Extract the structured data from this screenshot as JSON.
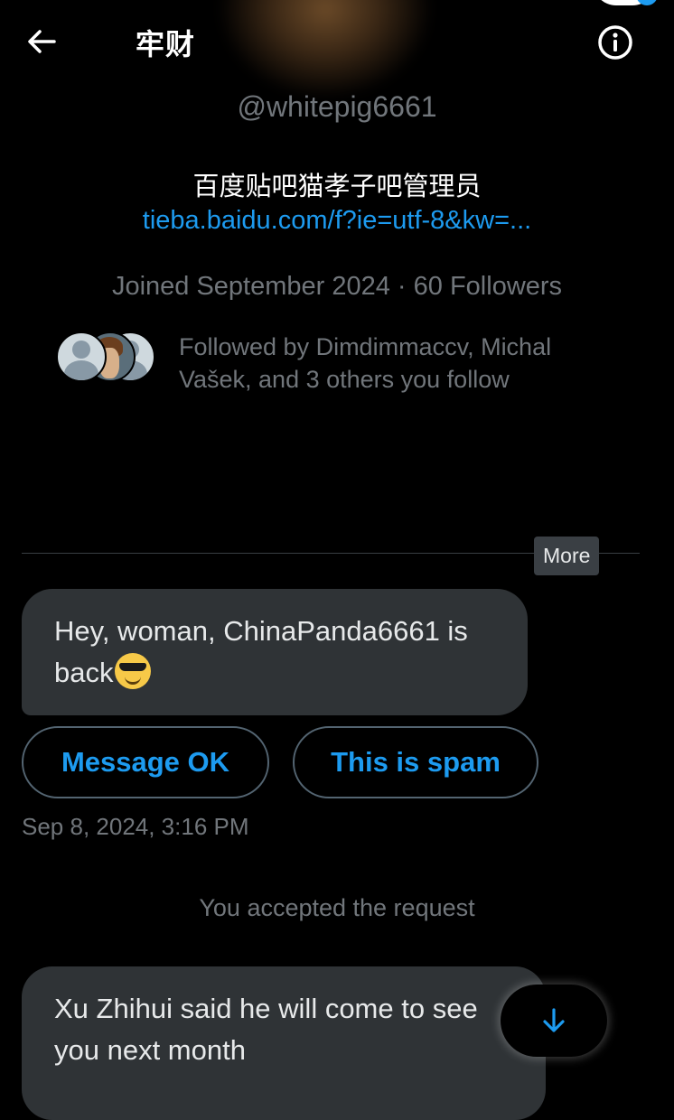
{
  "header": {
    "title": "牢财",
    "back_icon": "arrow-left-icon",
    "info_icon": "info-icon"
  },
  "profile": {
    "handle": "@whitepig6661",
    "bio": "百度贴吧猫孝子吧管理员",
    "link": "tieba.baidu.com/f?ie=utf-8&kw=...",
    "meta": "Joined September 2024 · 60 Followers",
    "followed_by": "Followed by Dimdimmaccv, Michal Vašek, and 3 others you follow"
  },
  "conversation": {
    "more_label": "More",
    "message1_text": "Hey, woman, ChinaPanda6661 is back",
    "message1_emoji": "smiling-face-with-sunglasses-icon",
    "message_ok_label": "Message OK",
    "spam_label": "This is spam",
    "timestamp": "Sep 8, 2024, 3:16 PM",
    "accepted_text": "You accepted the request",
    "message2_text": "Xu Zhihui said he will come to see you next month",
    "scroll_icon": "arrow-down-icon"
  },
  "colors": {
    "background": "#000000",
    "accent": "#1d9bf0",
    "bubble": "#2f3336",
    "muted": "#71767b"
  }
}
